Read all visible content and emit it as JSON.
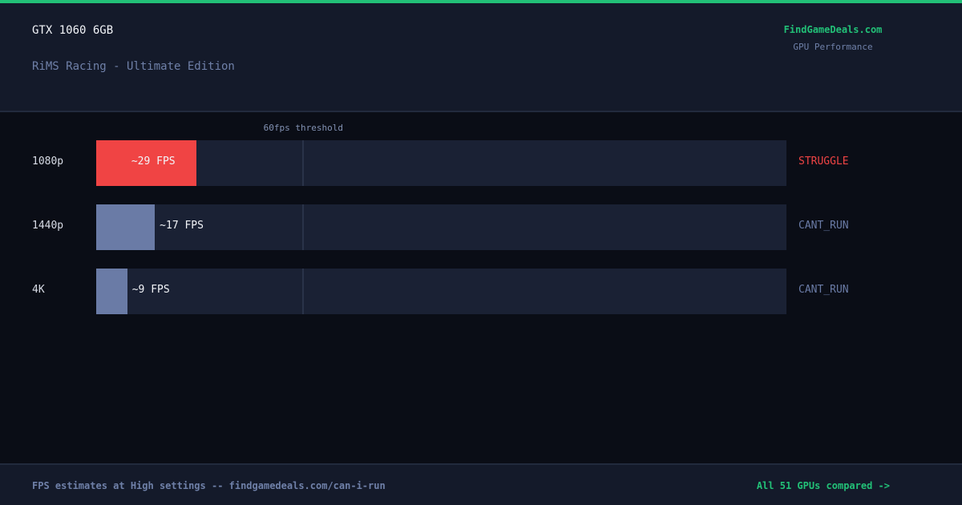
{
  "header": {
    "gpu_name": "GTX 1060 6GB",
    "game_title": "RiMS Racing - Ultimate Edition",
    "brand": "FindGameDeals.com",
    "brand_subtitle": "GPU Performance"
  },
  "chart_data": {
    "type": "bar",
    "orientation": "horizontal",
    "categories": [
      "1080p",
      "1440p",
      "4K"
    ],
    "values": [
      29,
      17,
      9
    ],
    "value_labels": [
      "~29 FPS",
      "~17 FPS",
      "~9 FPS"
    ],
    "statuses": [
      "STRUGGLE",
      "CANT_RUN",
      "CANT_RUN"
    ],
    "threshold": {
      "value": 60,
      "label": "60fps threshold"
    },
    "xlim": [
      0,
      200
    ],
    "grid": false
  },
  "colors": {
    "accent": "#22c077",
    "struggle": "#f04444",
    "cant_run_bar": "#6a7ba6",
    "cant_run_text": "#6a7ba6"
  },
  "footer": {
    "note": "FPS estimates at High settings -- findgamedeals.com/can-i-run",
    "link": "All 51 GPUs compared ->"
  }
}
